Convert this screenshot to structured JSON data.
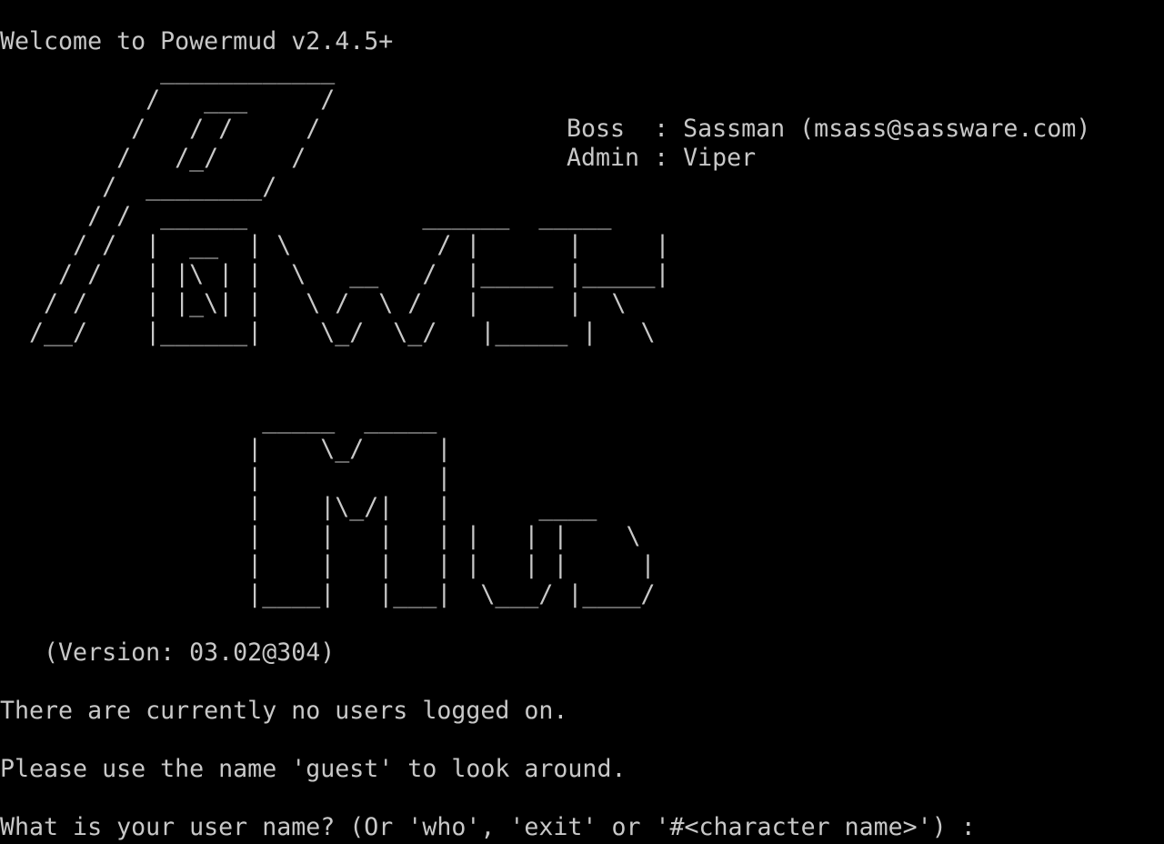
{
  "welcome": "Welcome to Powermud v2.4.5+",
  "staff": {
    "boss": "Boss  : Sassman (msass@sassware.com)",
    "admin": "Admin : Viper"
  },
  "logo_art": [
    "           ____________",
    "          /   ___     /",
    "         /   / /     /",
    "        /   /_/     /",
    "       /  ________/",
    "      / /  ______            ______  _____",
    "     / /  |  __  | \\          / |      |     |",
    "    / /   | |\\ | |  \\   __   /  |_____ |_____|",
    "   / /    | |_\\| |   \\ /  \\ /   |      |  \\",
    "  /__/    |______|    \\_/  \\_/   |_____ |   \\",
    "",
    "",
    "                  _____  _____",
    "                 |    \\_/     |",
    "                 |            |",
    "                 |    |\\_/|   |      ____",
    "                 |    |   |   | |   | |    \\",
    "                 |    |   |   | |   | |     |",
    "                 |____|   |___|  \\___/ |____/"
  ],
  "version": "   (Version: 03.02@304)",
  "status": "There are currently no users logged on.",
  "hint": "Please use the name 'guest' to look around.",
  "prompt": "What is your user name? (Or 'who', 'exit' or '#<character name>') : "
}
